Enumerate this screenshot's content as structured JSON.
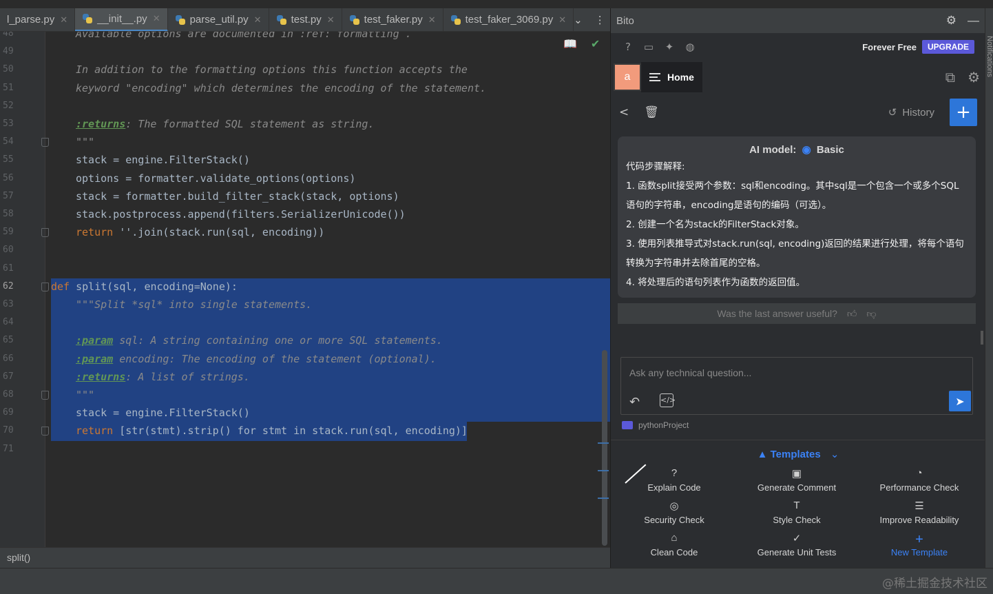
{
  "editor": {
    "tabs": [
      {
        "label": "l_parse.py",
        "active": false
      },
      {
        "label": "__init__.py",
        "active": true
      },
      {
        "label": "parse_util.py",
        "active": false
      },
      {
        "label": "test.py",
        "active": false
      },
      {
        "label": "test_faker.py",
        "active": false
      },
      {
        "label": "test_faker_3069.py",
        "active": false
      }
    ],
    "tab_close_glyph": "✕",
    "overflow_glyph": "⌄",
    "more_glyph": "⋮",
    "lines": [
      {
        "n": "48",
        "text": "Available options are documented in :ref:`formatting`."
      },
      {
        "n": "49",
        "text": ""
      },
      {
        "n": "50",
        "text": "In addition to the formatting options this function accepts the"
      },
      {
        "n": "51",
        "text": "keyword \"encoding\" which determines the encoding of the statement."
      },
      {
        "n": "52",
        "text": ""
      },
      {
        "n": "53",
        "tag": ":returns",
        "text": ": The formatted SQL statement as string."
      },
      {
        "n": "54",
        "text": "\"\"\""
      },
      {
        "n": "55",
        "text": "stack = engine.FilterStack()"
      },
      {
        "n": "56",
        "text": "options = formatter.validate_options(options)"
      },
      {
        "n": "57",
        "text": "stack = formatter.build_filter_stack(stack, options)"
      },
      {
        "n": "58",
        "text": "stack.postprocess.append(filters.SerializerUnicode())"
      },
      {
        "n": "59",
        "kw": "return",
        "text": " ''.join(stack.run(sql, encoding))"
      },
      {
        "n": "60",
        "text": ""
      },
      {
        "n": "61",
        "text": ""
      },
      {
        "n": "62",
        "kw": "def",
        "text": " split(sql, encoding=None):"
      },
      {
        "n": "63",
        "text": "\"\"\"Split *sql* into single statements."
      },
      {
        "n": "64",
        "text": ""
      },
      {
        "n": "65",
        "tag": ":param",
        "text": " sql: A string containing one or more SQL statements."
      },
      {
        "n": "66",
        "tag": ":param",
        "text": " encoding: The encoding of the statement (optional)."
      },
      {
        "n": "67",
        "tag": ":returns",
        "text": ": A list of strings."
      },
      {
        "n": "68",
        "text": "\"\"\""
      },
      {
        "n": "69",
        "text": "stack = engine.FilterStack()"
      },
      {
        "n": "70",
        "kw": "return",
        "text": " [str(stmt).strip() for stmt in stack.run(sql, encoding)]"
      },
      {
        "n": "71",
        "text": ""
      }
    ],
    "breadcrumb": "split()",
    "reader_mode_glyph": "📖",
    "check_glyph": "✔"
  },
  "bito": {
    "title": "Bito",
    "settings_glyph": "⚙",
    "minimize_glyph": "—",
    "plan_label": "Forever Free",
    "upgrade_label": "UPGRADE",
    "avatar_letter": "a",
    "home_tab_label": "Home",
    "history_label": "History",
    "add_glyph": "+",
    "model_prefix": "AI model:",
    "model_name": "Basic",
    "answer_lines": [
      "代码步骤解释:",
      "1. 函数split接受两个参数：sql和encoding。其中sql是一个包含一个或多个SQL语句的字符串，encoding是语句的编码（可选）。",
      "2. 创建一个名为stack的FilterStack对象。",
      "3. 使用列表推导式对stack.run(sql, encoding)返回的结果进行处理，将每个语句转换为字符串并去除首尾的空格。",
      "4. 将处理后的语句列表作为函数的返回值。"
    ],
    "feedback_prompt": "Was the last answer useful?",
    "input_placeholder": "Ask any technical question...",
    "project_name": "pythonProject",
    "templates_label": "Templates",
    "templates": [
      {
        "label": "Explain Code",
        "icon": "question-circle-icon"
      },
      {
        "label": "Generate Comment",
        "icon": "comment-plus-icon"
      },
      {
        "label": "Performance Check",
        "icon": "gauge-icon"
      },
      {
        "label": "Security Check",
        "icon": "shield-icon"
      },
      {
        "label": "Style Check",
        "icon": "text-size-icon"
      },
      {
        "label": "Improve Readability",
        "icon": "zoom-lines-icon"
      },
      {
        "label": "Clean Code",
        "icon": "broom-icon"
      },
      {
        "label": "Generate Unit Tests",
        "icon": "check-circle-icon"
      },
      {
        "label": "New Template",
        "icon": "plus-icon"
      }
    ],
    "side_strip_label": "Notifications"
  },
  "watermark": "@稀土掘金技术社区",
  "colors": {
    "accent": "#3b82f6",
    "selection": "#214283",
    "upgrade": "#5b59d9",
    "avatar": "#f29b7c"
  }
}
